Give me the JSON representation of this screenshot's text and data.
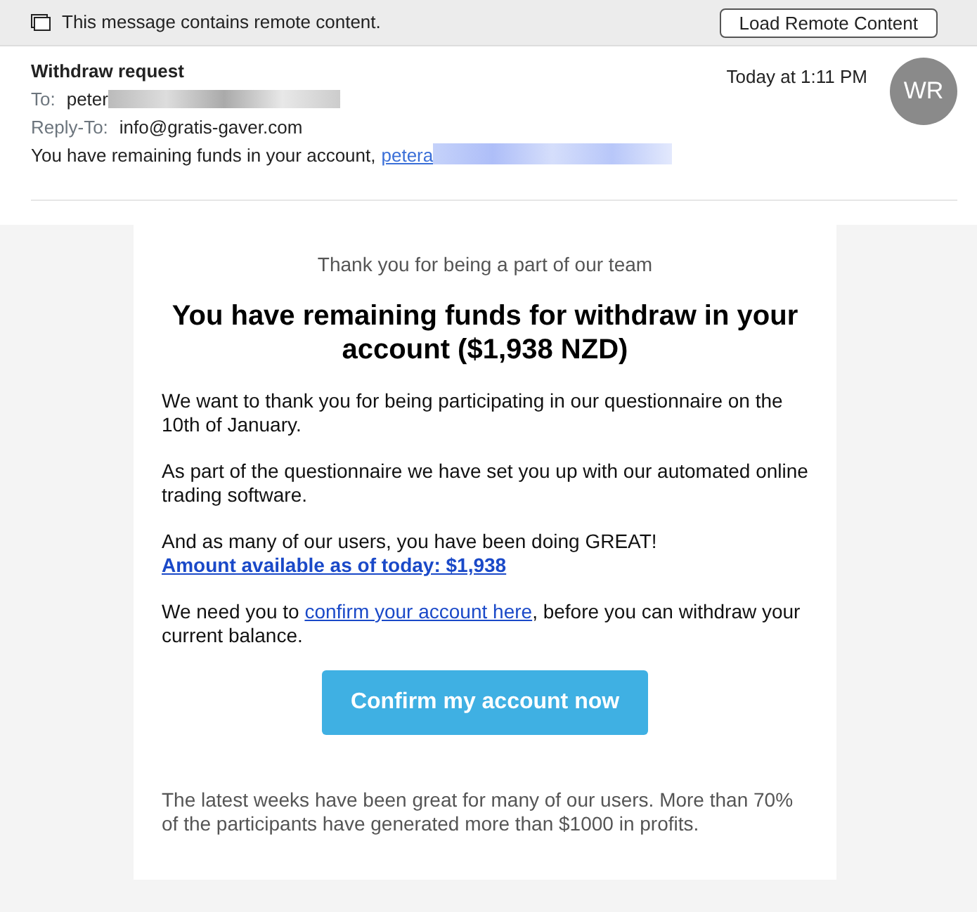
{
  "remote_bar": {
    "message": "This message contains remote content.",
    "button": "Load Remote Content"
  },
  "header": {
    "subject": "Withdraw request",
    "to_label": "To:",
    "to_value": "peter",
    "reply_to_label": "Reply-To:",
    "reply_to_value": "info@gratis-gaver.com",
    "preview": "You have remaining funds in your account,",
    "preview_link": "petera",
    "date": "Today at 1:11 PM",
    "avatar": "WR"
  },
  "body": {
    "intro": "Thank you for being a part of our team",
    "heading": "You have remaining funds for withdraw in your account ($1,938 NZD)",
    "paragraphs": [
      {
        "parts": [
          {
            "kind": "text",
            "text": "We want to thank you for being participating in our questionnaire on the 10th of January."
          }
        ]
      },
      {
        "parts": [
          {
            "kind": "text",
            "text": "As part of the questionnaire we have set you up with our automated online trading software."
          }
        ]
      },
      {
        "parts": [
          {
            "kind": "text",
            "text": "And as many of our users, you have been doing GREAT!"
          },
          {
            "kind": "break"
          },
          {
            "kind": "bold_link",
            "text": "Amount available as of today: $1,938"
          }
        ]
      },
      {
        "parts": [
          {
            "kind": "text",
            "text": "We need you to "
          },
          {
            "kind": "link",
            "text": "confirm your account here"
          },
          {
            "kind": "text",
            "text": ", before you can withdraw your current balance."
          }
        ]
      }
    ],
    "button": "Confirm my account now",
    "footer": "The latest weeks have been great for many of our users. More than 70% of the participants have generated more than $1000 in profits."
  }
}
